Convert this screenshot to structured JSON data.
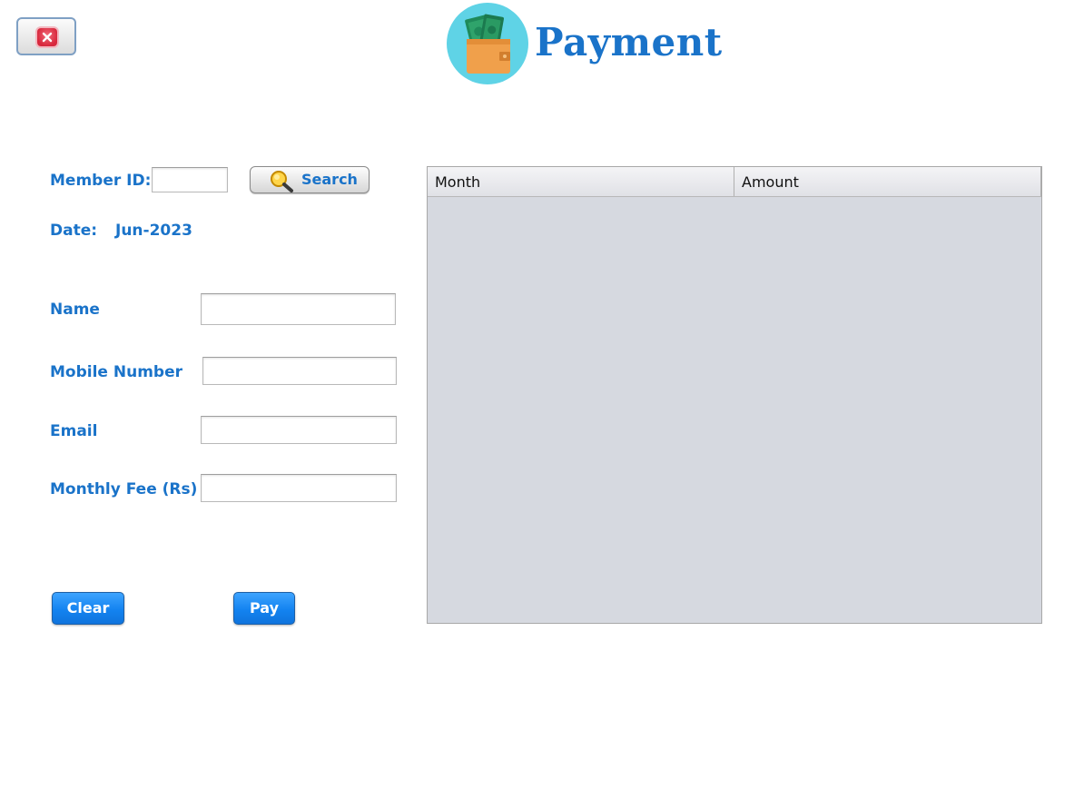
{
  "header": {
    "title": "Payment",
    "logo_icon": "wallet-money-icon"
  },
  "close_button": {
    "icon": "close-icon"
  },
  "form": {
    "member_id": {
      "label": "Member ID:",
      "value": ""
    },
    "search_button": {
      "label": "Search",
      "icon": "magnifier-icon"
    },
    "date": {
      "label": "Date:",
      "value": "Jun-2023"
    },
    "name": {
      "label": "Name",
      "value": ""
    },
    "mobile": {
      "label": "Mobile Number",
      "value": ""
    },
    "email": {
      "label": "Email",
      "value": ""
    },
    "monthly_fee": {
      "label": "Monthly Fee (Rs)",
      "value": ""
    }
  },
  "actions": {
    "clear_label": "Clear",
    "pay_label": "Pay"
  },
  "table": {
    "columns": [
      "Month",
      "Amount"
    ],
    "rows": []
  },
  "colors": {
    "accent": "#1a73c9",
    "button_blue": "#1383f0",
    "table_bg": "#d6d9e0"
  }
}
